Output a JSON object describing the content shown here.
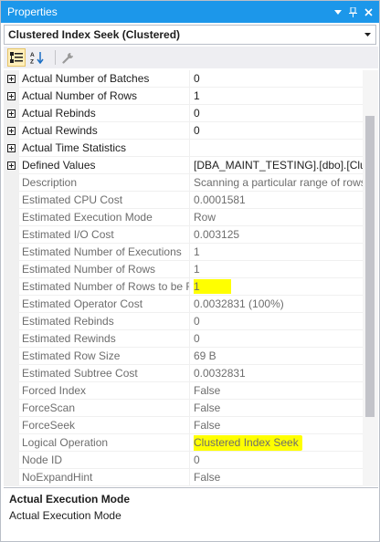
{
  "window": {
    "title": "Properties",
    "buttons": [
      "dropdown-arrow",
      "pin",
      "close"
    ]
  },
  "object_selector": {
    "value": "Clustered Index Seek (Clustered)"
  },
  "toolbar": {
    "buttons": [
      {
        "name": "categorized",
        "icon": "categorized-icon",
        "active": true
      },
      {
        "name": "alphabetical",
        "icon": "sort-az-icon",
        "active": false
      },
      {
        "name": "property-pages",
        "icon": "wrench-icon",
        "active": false
      }
    ]
  },
  "properties": [
    {
      "name": "Actual Number of Batches",
      "value": "0",
      "expandable": true,
      "readonly": false
    },
    {
      "name": "Actual Number of Rows",
      "value": "1",
      "expandable": true,
      "readonly": false
    },
    {
      "name": "Actual Rebinds",
      "value": "0",
      "expandable": true,
      "readonly": false
    },
    {
      "name": "Actual Rewinds",
      "value": "0",
      "expandable": true,
      "readonly": false
    },
    {
      "name": "Actual Time Statistics",
      "value": "",
      "expandable": true,
      "readonly": false
    },
    {
      "name": "Defined Values",
      "value": "[DBA_MAINT_TESTING].[dbo].[Clu",
      "expandable": true,
      "readonly": false
    },
    {
      "name": "Description",
      "value": "Scanning a particular range of rows",
      "expandable": false,
      "readonly": true
    },
    {
      "name": "Estimated CPU Cost",
      "value": "0.0001581",
      "expandable": false,
      "readonly": true
    },
    {
      "name": "Estimated Execution Mode",
      "value": "Row",
      "expandable": false,
      "readonly": true
    },
    {
      "name": "Estimated I/O Cost",
      "value": "0.003125",
      "expandable": false,
      "readonly": true
    },
    {
      "name": "Estimated Number of Executions",
      "value": "1",
      "expandable": false,
      "readonly": true
    },
    {
      "name": "Estimated Number of Rows",
      "value": "1",
      "expandable": false,
      "readonly": true
    },
    {
      "name": "Estimated Number of Rows to be R",
      "value": "1",
      "expandable": false,
      "readonly": true,
      "highlight": true
    },
    {
      "name": "Estimated Operator Cost",
      "value": "0.0032831 (100%)",
      "expandable": false,
      "readonly": true
    },
    {
      "name": "Estimated Rebinds",
      "value": "0",
      "expandable": false,
      "readonly": true
    },
    {
      "name": "Estimated Rewinds",
      "value": "0",
      "expandable": false,
      "readonly": true
    },
    {
      "name": "Estimated Row Size",
      "value": "69 B",
      "expandable": false,
      "readonly": true
    },
    {
      "name": "Estimated Subtree Cost",
      "value": "0.0032831",
      "expandable": false,
      "readonly": true
    },
    {
      "name": "Forced Index",
      "value": "False",
      "expandable": false,
      "readonly": true
    },
    {
      "name": "ForceScan",
      "value": "False",
      "expandable": false,
      "readonly": true
    },
    {
      "name": "ForceSeek",
      "value": "False",
      "expandable": false,
      "readonly": true
    },
    {
      "name": "Logical Operation",
      "value": "Clustered Index Seek",
      "expandable": false,
      "readonly": true,
      "highlight": true
    },
    {
      "name": "Node ID",
      "value": "0",
      "expandable": false,
      "readonly": true
    },
    {
      "name": "NoExpandHint",
      "value": "False",
      "expandable": false,
      "readonly": true
    }
  ],
  "description_pane": {
    "title": "Actual Execution Mode",
    "text": "Actual Execution Mode"
  },
  "colors": {
    "titlebar": "#1c97ea",
    "highlight": "#ffff00",
    "readonly_text": "#6d6d6d"
  }
}
